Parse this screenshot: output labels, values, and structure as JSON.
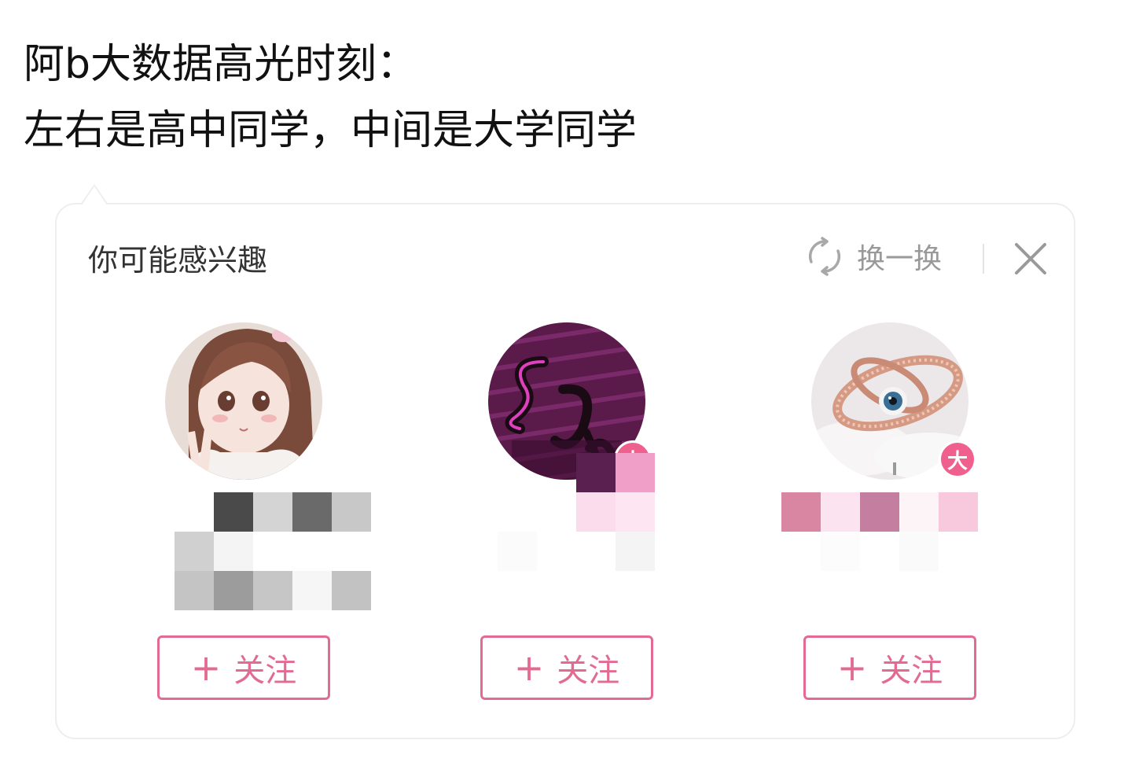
{
  "caption": {
    "line1": "阿b大数据高光时刻：",
    "line2": "左右是高中同学，中间是大学同学"
  },
  "panel": {
    "title": "你可能感兴趣",
    "refresh_label": "换一换",
    "refresh_icon": "refresh-icon",
    "close_icon": "close-icon"
  },
  "users": [
    {
      "avatar": "anime-girl-peace-sign-avatar",
      "badge": "",
      "follow_label": "关注",
      "name_censored": true
    },
    {
      "avatar": "purple-sdk-logo-avatar",
      "badge": "大",
      "follow_label": "关注",
      "name_censored": true
    },
    {
      "avatar": "rose-gold-eye-ring-avatar",
      "badge": "大",
      "follow_label": "关注",
      "name_censored": true
    }
  ],
  "colors": {
    "accent": "#e36b92",
    "badge": "#f0608e",
    "muted": "#999999",
    "card_border": "#eeeeee"
  }
}
